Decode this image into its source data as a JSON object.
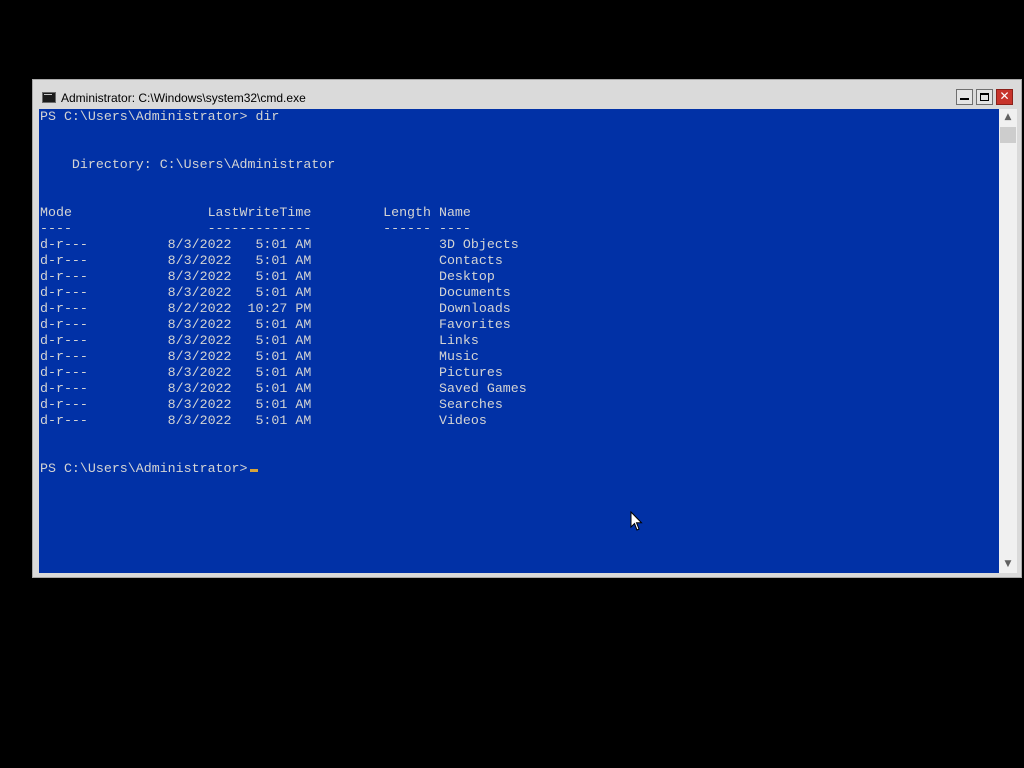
{
  "window": {
    "title": "Administrator: C:\\Windows\\system32\\cmd.exe",
    "icon": "console-icon"
  },
  "title_controls": {
    "minimize_icon": "minimize-icon",
    "maximize_icon": "maximize-icon",
    "close_icon": "close-icon",
    "close_glyph": "✕"
  },
  "console": {
    "lines": [
      "PS C:\\Users\\Administrator> dir",
      "",
      "",
      "    Directory: C:\\Users\\Administrator",
      "",
      "",
      "Mode                 LastWriteTime         Length Name",
      "----                 -------------         ------ ----",
      "d-r---          8/3/2022   5:01 AM                3D Objects",
      "d-r---          8/3/2022   5:01 AM                Contacts",
      "d-r---          8/3/2022   5:01 AM                Desktop",
      "d-r---          8/3/2022   5:01 AM                Documents",
      "d-r---          8/2/2022  10:27 PM                Downloads",
      "d-r---          8/3/2022   5:01 AM                Favorites",
      "d-r---          8/3/2022   5:01 AM                Links",
      "d-r---          8/3/2022   5:01 AM                Music",
      "d-r---          8/3/2022   5:01 AM                Pictures",
      "d-r---          8/3/2022   5:01 AM                Saved Games",
      "d-r---          8/3/2022   5:01 AM                Searches",
      "d-r---          8/3/2022   5:01 AM                Videos",
      "",
      ""
    ],
    "prompt": "PS C:\\Users\\Administrator>",
    "background_color": "#0131a6",
    "text_color": "#d4d4d4",
    "cursor_color": "#d6a33a"
  },
  "scrollbar": {
    "up_glyph": "▲",
    "down_glyph": "▼"
  }
}
